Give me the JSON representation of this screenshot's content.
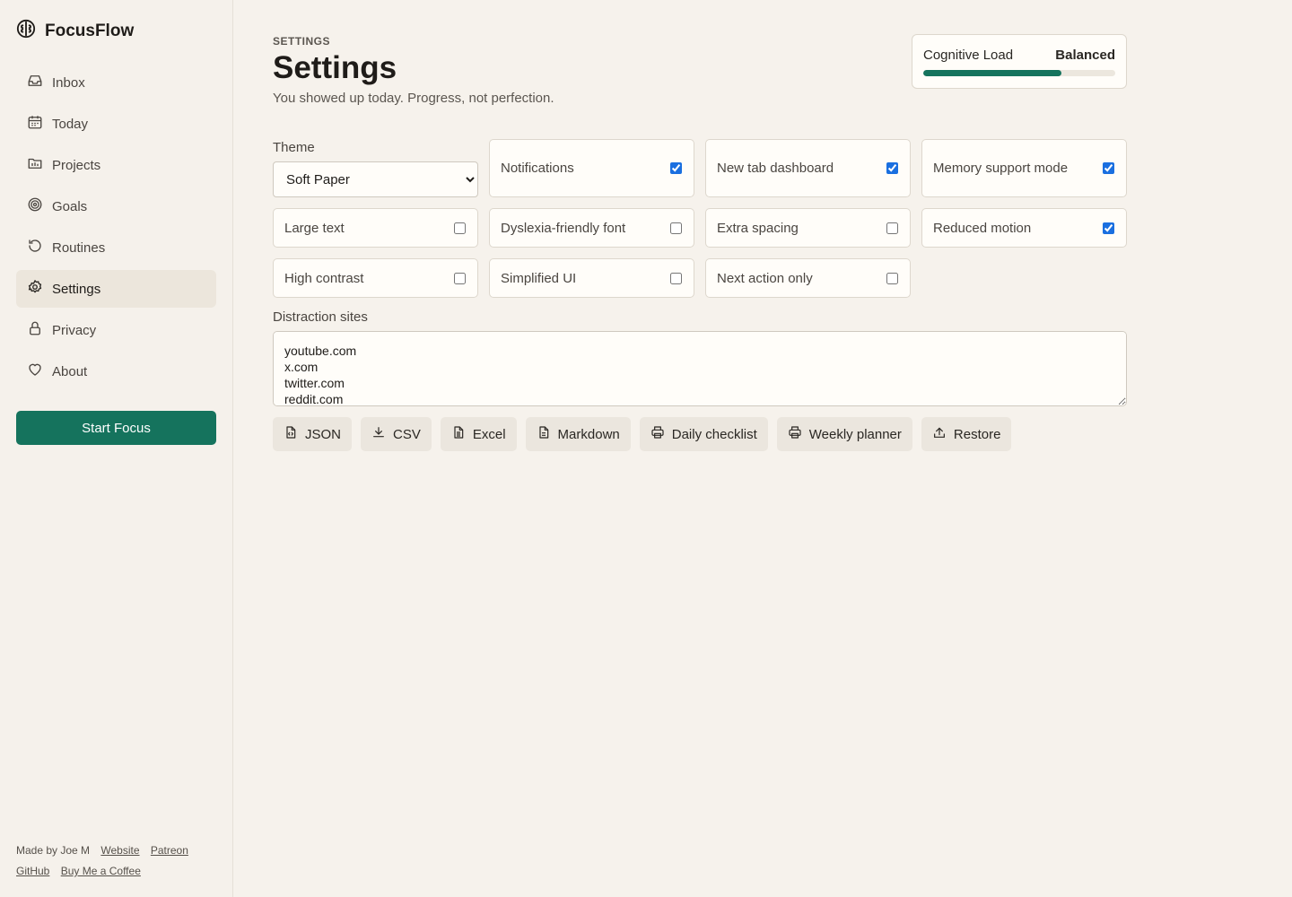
{
  "app": {
    "name": "FocusFlow"
  },
  "sidebar": {
    "items": [
      {
        "label": "Inbox",
        "icon": "inbox-icon",
        "active": false
      },
      {
        "label": "Today",
        "icon": "calendar-icon",
        "active": false
      },
      {
        "label": "Projects",
        "icon": "folder-icon",
        "active": false
      },
      {
        "label": "Goals",
        "icon": "target-icon",
        "active": false
      },
      {
        "label": "Routines",
        "icon": "history-icon",
        "active": false
      },
      {
        "label": "Settings",
        "icon": "gear-icon",
        "active": true
      },
      {
        "label": "Privacy",
        "icon": "lock-icon",
        "active": false
      },
      {
        "label": "About",
        "icon": "heart-icon",
        "active": false
      }
    ],
    "start_focus": "Start Focus"
  },
  "footer": {
    "made_by": "Made by Joe M",
    "links": [
      "Website",
      "Patreon",
      "GitHub",
      "Buy Me a Coffee"
    ]
  },
  "header": {
    "eyebrow": "SETTINGS",
    "title": "Settings",
    "subtitle": "You showed up today. Progress, not perfection."
  },
  "cognitive_load": {
    "label": "Cognitive Load",
    "value": "Balanced",
    "level": 0.72
  },
  "theme": {
    "label": "Theme",
    "selected": "Soft Paper"
  },
  "options": {
    "notifications": {
      "label": "Notifications",
      "checked": true
    },
    "new_tab_dashboard": {
      "label": "New tab dashboard",
      "checked": true
    },
    "memory_support_mode": {
      "label": "Memory support mode",
      "checked": true
    },
    "large_text": {
      "label": "Large text",
      "checked": false
    },
    "dyslexia_font": {
      "label": "Dyslexia-friendly font",
      "checked": false
    },
    "extra_spacing": {
      "label": "Extra spacing",
      "checked": false
    },
    "reduced_motion": {
      "label": "Reduced motion",
      "checked": true
    },
    "high_contrast": {
      "label": "High contrast",
      "checked": false
    },
    "simplified_ui": {
      "label": "Simplified UI",
      "checked": false
    },
    "next_action_only": {
      "label": "Next action only",
      "checked": false
    }
  },
  "distraction_sites": {
    "label": "Distraction sites",
    "value": "youtube.com\nx.com\ntwitter.com\nreddit.com"
  },
  "actions": [
    {
      "label": "JSON",
      "icon": "file-code-icon"
    },
    {
      "label": "CSV",
      "icon": "download-icon"
    },
    {
      "label": "Excel",
      "icon": "file-spreadsheet-icon"
    },
    {
      "label": "Markdown",
      "icon": "file-text-icon"
    },
    {
      "label": "Daily checklist",
      "icon": "printer-icon"
    },
    {
      "label": "Weekly planner",
      "icon": "printer-icon"
    },
    {
      "label": "Restore",
      "icon": "upload-icon"
    }
  ],
  "colors": {
    "accent": "#15735d",
    "background": "#f6f2ec",
    "checkbox": "#1a6fe0"
  }
}
